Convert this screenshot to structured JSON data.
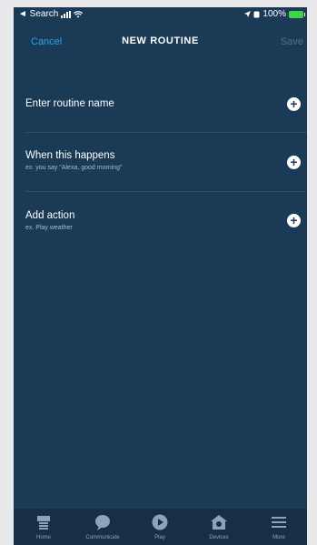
{
  "status_bar": {
    "back_label": "◄ Search",
    "battery_text": "100%"
  },
  "header": {
    "cancel_label": "Cancel",
    "title": "NEW ROUTINE",
    "save_label": "Save"
  },
  "rows": [
    {
      "label": "Enter routine name",
      "sub": ""
    },
    {
      "label": "When this happens",
      "sub": "ex. you say \"Alexa, good morning\""
    },
    {
      "label": "Add action",
      "sub": "ex. Play weather"
    }
  ],
  "nav": {
    "items": [
      {
        "label": "Home",
        "icon": "home-icon"
      },
      {
        "label": "Communicate",
        "icon": "chat-bubble-icon"
      },
      {
        "label": "Play",
        "icon": "play-icon"
      },
      {
        "label": "Devices",
        "icon": "devices-house-icon"
      },
      {
        "label": "More",
        "icon": "menu-lines-icon"
      }
    ]
  },
  "colors": {
    "background": "#1a3a56",
    "accent": "#2aa7e8",
    "nav_bar": "#172f45"
  }
}
